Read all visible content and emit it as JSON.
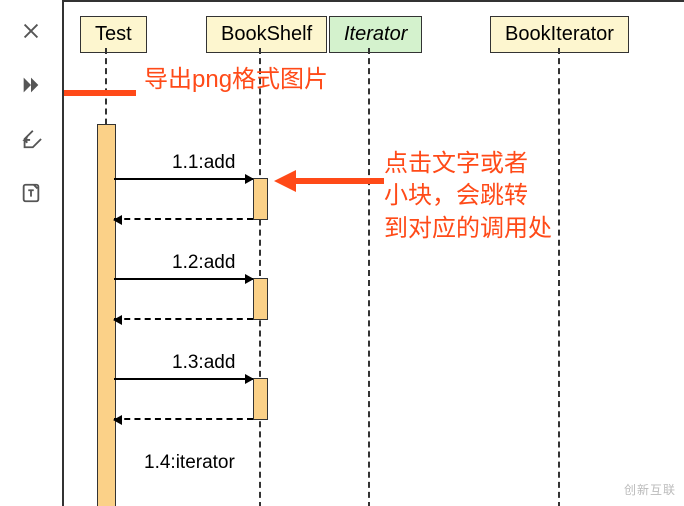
{
  "toolbar": {
    "close": "close",
    "forward": "forward",
    "export": "export",
    "text": "text-mode"
  },
  "lifelines": {
    "test": "Test",
    "bookshelf": "BookShelf",
    "iterator": "Iterator",
    "bookiterator": "BookIterator"
  },
  "calls": {
    "c1": "1.1:add",
    "c2": "1.2:add",
    "c3": "1.3:add",
    "c4": "1.4:iterator"
  },
  "annotations": {
    "export_png": "导出png格式图片",
    "click_jump": "点击文字或者\n小块，会跳转\n到对应的调用处"
  },
  "watermark": "创新互联"
}
